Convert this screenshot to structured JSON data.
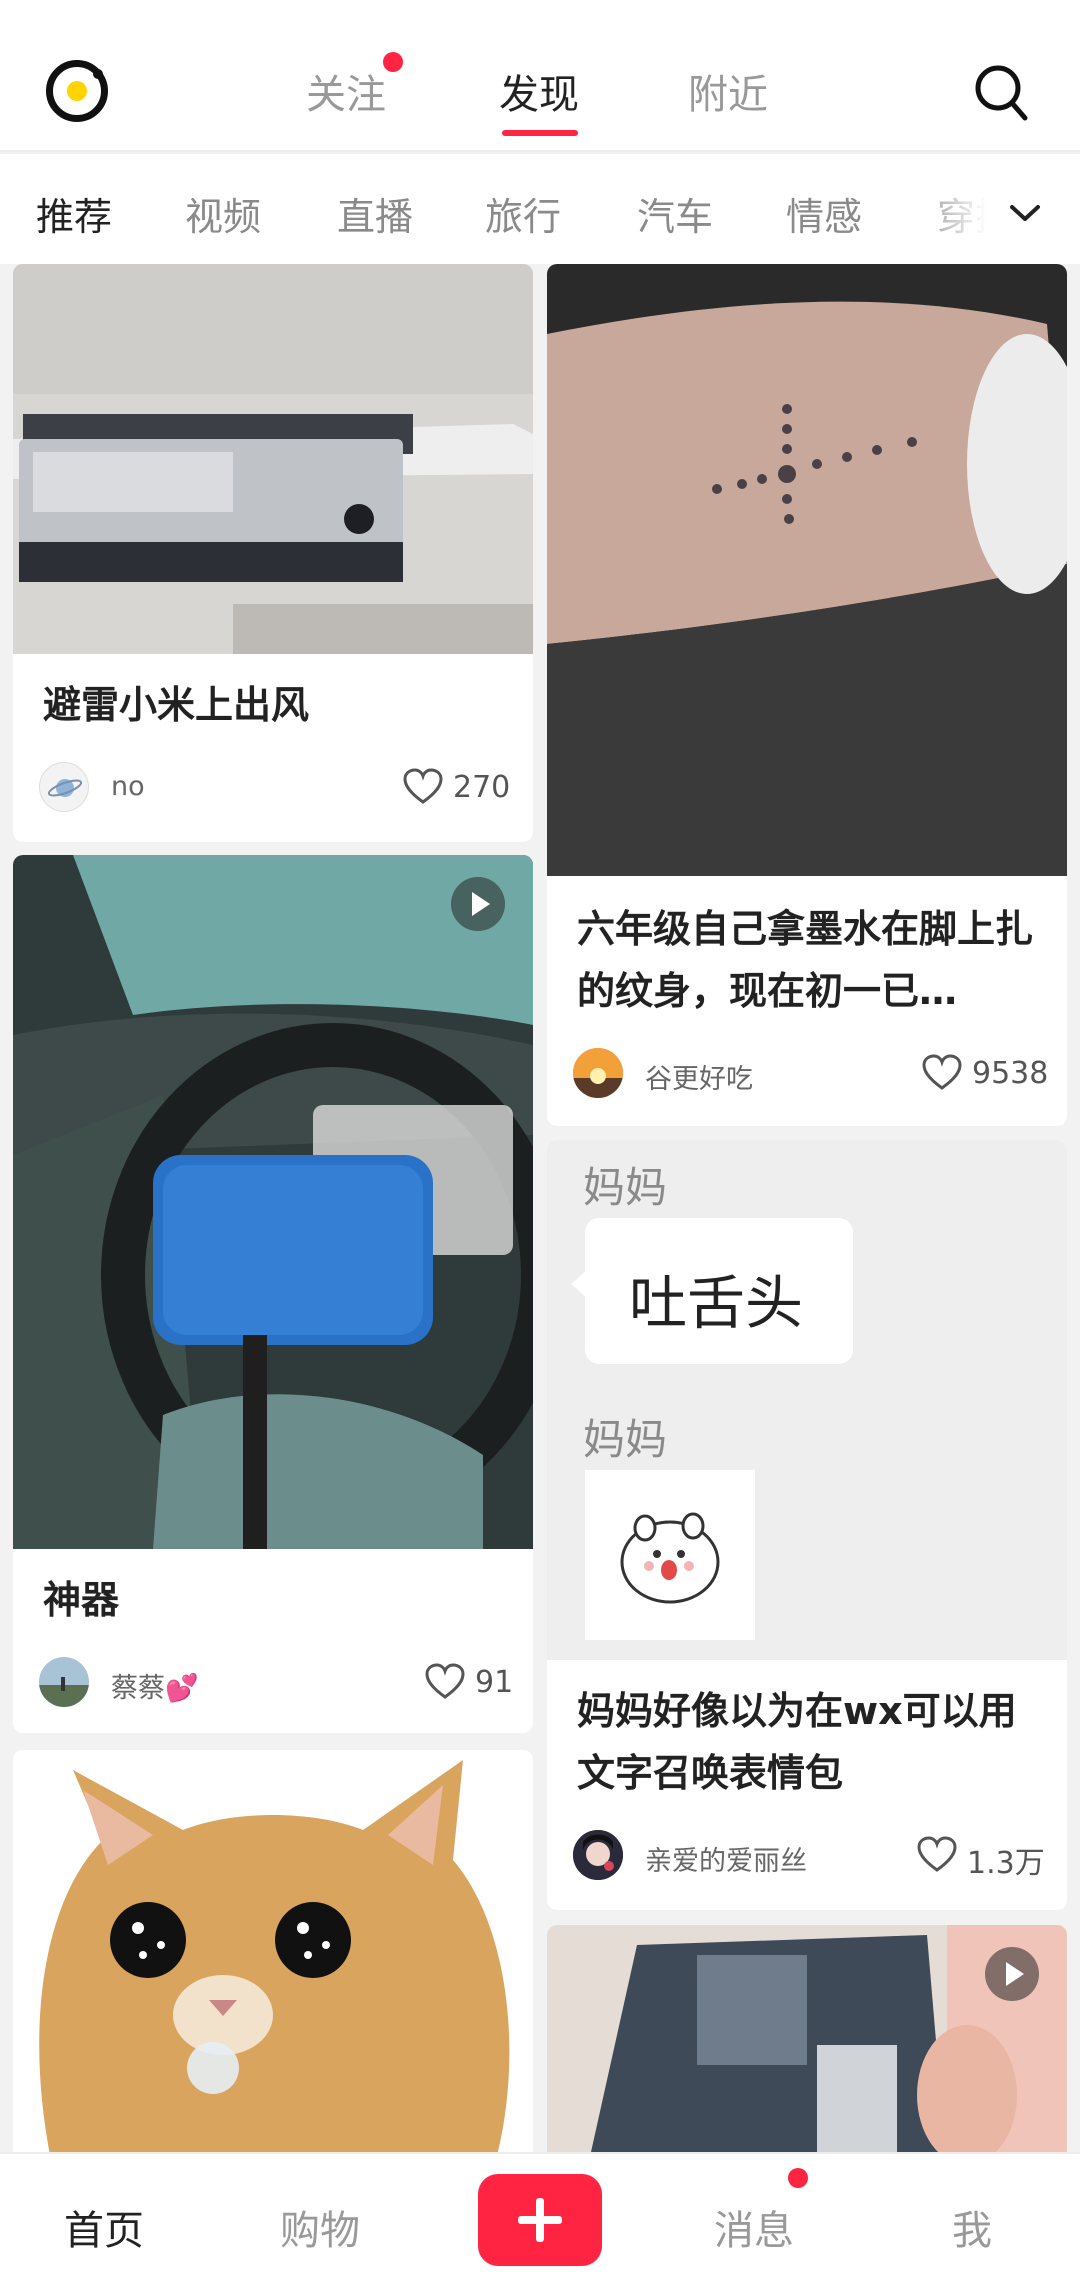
{
  "header": {
    "tabs": [
      {
        "label": "关注",
        "active": false,
        "has_dot": true
      },
      {
        "label": "发现",
        "active": true,
        "has_dot": false
      },
      {
        "label": "附近",
        "active": false,
        "has_dot": false
      }
    ],
    "accent_color": "#ff2442"
  },
  "categories": [
    "推荐",
    "视频",
    "直播",
    "旅行",
    "汽车",
    "情感",
    "穿搭"
  ],
  "feed": [
    {
      "title": "避雷小米上出风",
      "author": "no",
      "likes": "270",
      "avatar": "planet-avatar",
      "is_video": false
    },
    {
      "title": "六年级自己拿墨水在脚上扎的纹身，现在初一已…",
      "author": "谷更好吃",
      "likes": "9538",
      "avatar": "sunset-avatar",
      "is_video": false
    },
    {
      "title": "神器",
      "author": "蔡蔡💕",
      "likes": "91",
      "avatar": "landscape-avatar",
      "is_video": true
    },
    {
      "title": "妈妈好像以为在wx可以用文字召唤表情包",
      "author": "亲爱的爱丽丝",
      "likes": "1.3万",
      "avatar": "anime-avatar",
      "is_video": false,
      "image_text": {
        "sender1": "妈妈",
        "bubble": "吐舌头",
        "sender2": "妈妈"
      }
    },
    {
      "title": "",
      "author": "",
      "likes": "",
      "avatar": "",
      "is_video": false
    },
    {
      "title": "",
      "author": "",
      "likes": "",
      "avatar": "",
      "is_video": true
    }
  ],
  "bottom_nav": {
    "items": [
      {
        "label": "首页",
        "active": true
      },
      {
        "label": "购物",
        "active": false
      },
      {
        "label": "消息",
        "active": false,
        "has_dot": true
      },
      {
        "label": "我",
        "active": false
      }
    ]
  }
}
